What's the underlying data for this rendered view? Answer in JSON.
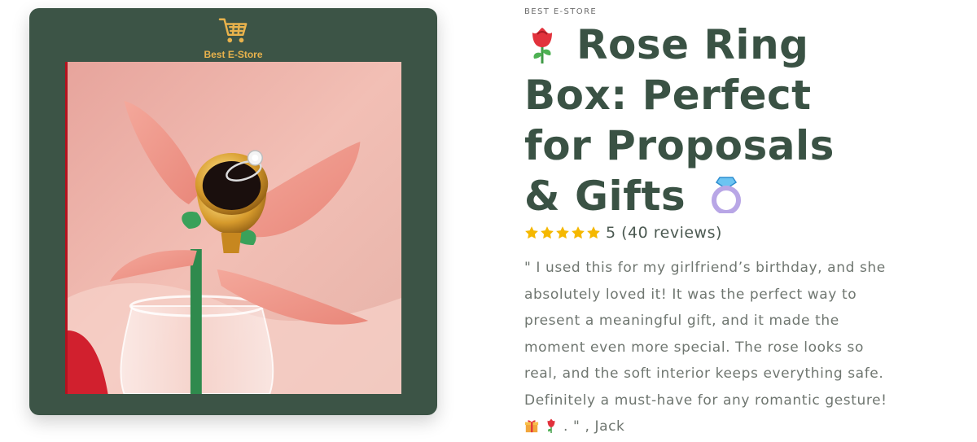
{
  "store": {
    "brand_name": "Best E-Store",
    "cart_icon": "shopping-cart-icon",
    "brand_color": "#e8b24c",
    "card_color": "#3c5446"
  },
  "product": {
    "eyebrow": "BEST E-STORE",
    "title_emoji_icon": "rose-emoji-icon",
    "title_text": "Rose Ring Box: Perfect for Proposals & Gifts",
    "title_trailing_icon": "ring-emoji-icon",
    "image_alt": "Rose-shaped ring box holding a diamond ring",
    "rating": {
      "stars": 5,
      "text": "5 (40 reviews)",
      "star_color": "#f5b800"
    },
    "review": {
      "text": "\" I used this for my girlfriend’s birthday, and she absolutely loved it! It was the perfect way to present a meaningful gift, and it made the moment even more special. The rose looks so real, and the soft interior keeps everything safe. Definitely a must-have for any romantic gesture!",
      "emoji_icons": [
        "gift-emoji-icon",
        "rose-emoji-icon"
      ],
      "suffix": ". \" , Jack"
    }
  }
}
